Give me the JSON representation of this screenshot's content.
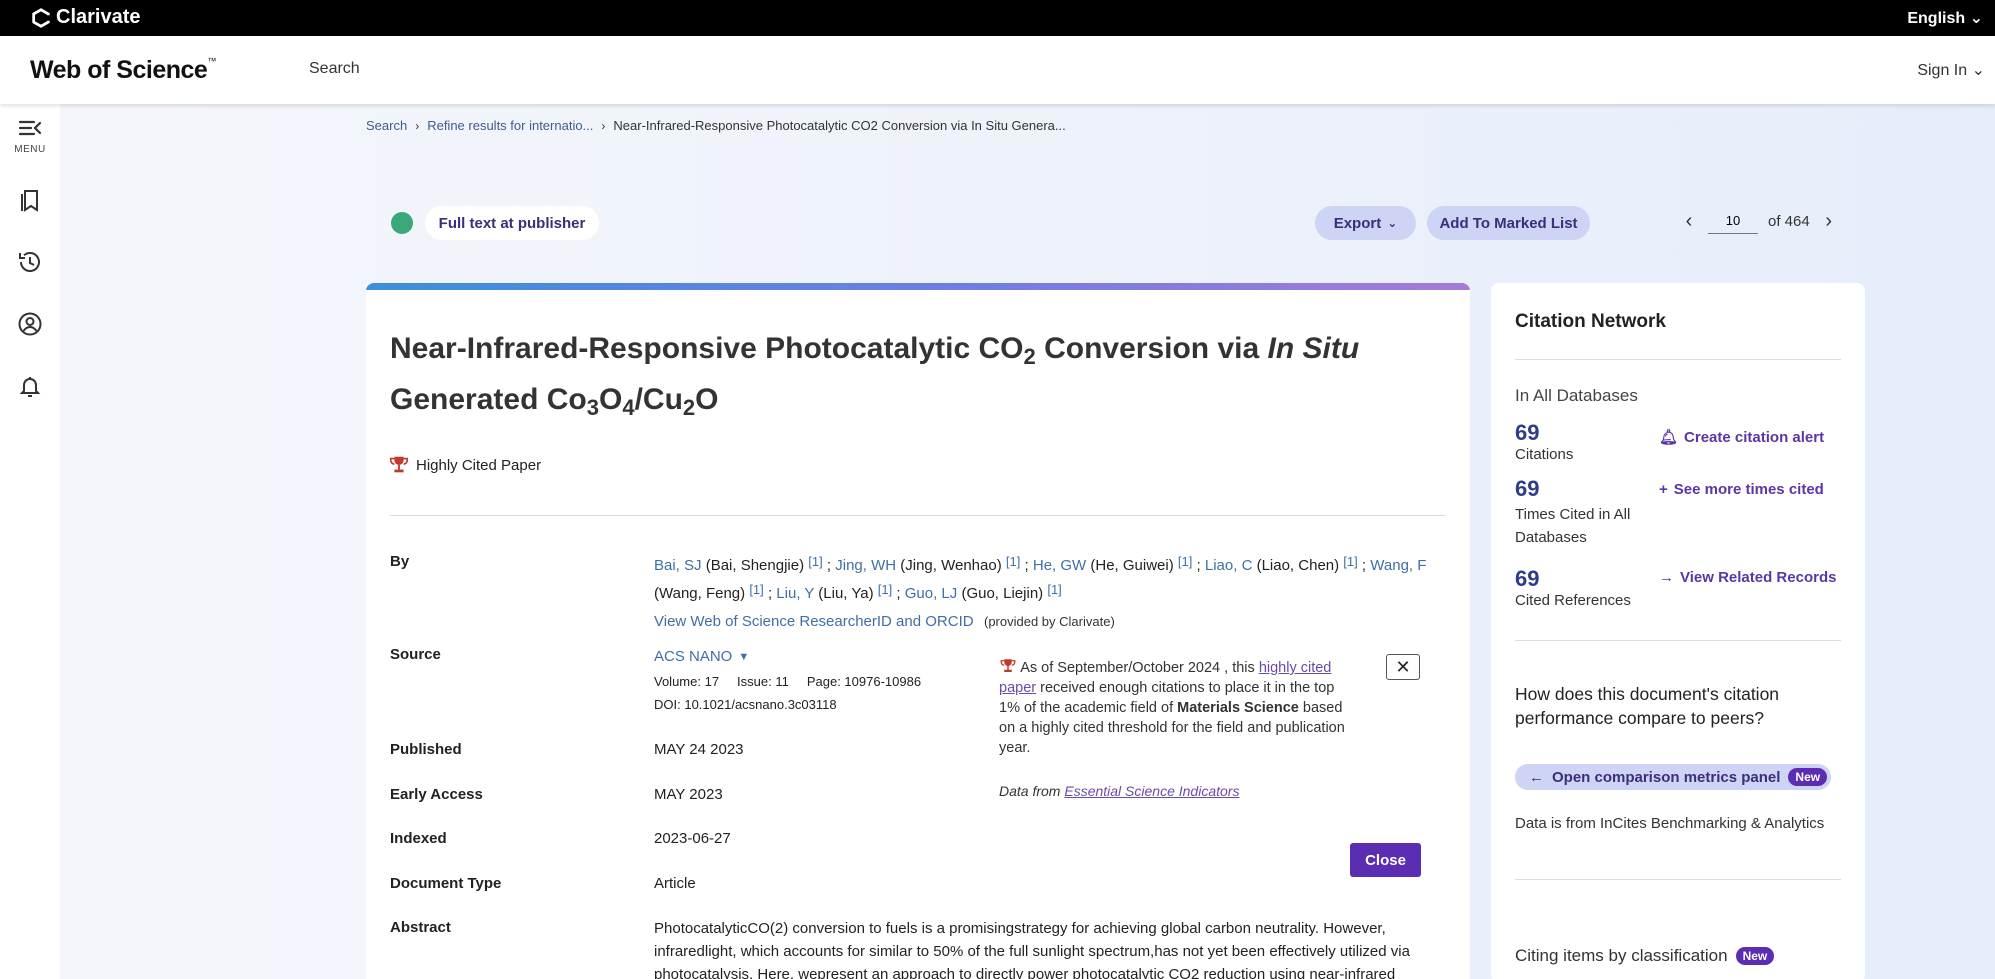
{
  "topbar": {
    "brand": "Clarivate",
    "language": "English ⌄"
  },
  "header": {
    "logo": "Web of Science",
    "logo_tm": "™",
    "search": "Search",
    "signin": "Sign In ⌄"
  },
  "sidebar": {
    "menu_label": "MENU"
  },
  "breadcrumb": {
    "items": [
      "Search",
      "Refine results for internatio...",
      "Near-Infrared-Responsive Photocatalytic CO2 Conversion via In Situ Genera..."
    ]
  },
  "actions": {
    "full_text": "Full text at publisher",
    "export": "Export",
    "add_marked": "Add To Marked List"
  },
  "pager": {
    "current": "10",
    "of_label": "of 464"
  },
  "record": {
    "title_part1": "Near-Infrared-Responsive Photocatalytic CO",
    "title_sub1": "2",
    "title_part2": " Conversion via ",
    "title_italic": "In Situ",
    "title_part3": "Generated Co",
    "title_sub2": "3",
    "title_part4": "O",
    "title_sub3": "4",
    "title_part5": "/Cu",
    "title_sub4": "2",
    "title_part6": "O",
    "highly_cited": "Highly Cited Paper",
    "by_label": "By",
    "authors": [
      {
        "short": "Bai, SJ",
        "full": " (Bai, Shengjie) ",
        "ref": "[1]"
      },
      {
        "short": "Jing, WH",
        "full": " (Jing, Wenhao) ",
        "ref": "[1]"
      },
      {
        "short": "He, GW",
        "full": " (He, Guiwei) ",
        "ref": "[1]"
      },
      {
        "short": "Liao, C",
        "full": " (Liao, Chen) ",
        "ref": "[1]"
      },
      {
        "short": "Wang, F",
        "full": " (Wang, Feng) ",
        "ref": "[1]"
      },
      {
        "short": "Liu, Y",
        "full": " (Liu, Ya) ",
        "ref": "[1]"
      },
      {
        "short": "Guo, LJ",
        "full": " (Guo, Liejin) ",
        "ref": "[1]"
      }
    ],
    "researcher_link": "View Web of Science ResearcherID and ORCID",
    "researcher_note": "(provided by Clarivate)",
    "source_label": "Source",
    "source_name": "ACS NANO",
    "volume": "Volume: 17",
    "issue": "Issue: 11",
    "page": "Page: 10976-10986",
    "doi": "DOI: 10.1021/acsnano.3c03118",
    "published_label": "Published",
    "published": "MAY 24 2023",
    "early_access_label": "Early Access",
    "early_access": "MAY 2023",
    "indexed_label": "Indexed",
    "indexed": "2023-06-27",
    "doctype_label": "Document Type",
    "doctype": "Article",
    "abstract_label": "Abstract",
    "abstract": "PhotocatalyticCO(2) conversion to fuels is a promisingstrategy for achieving global carbon neutrality. However, infraredlight, which accounts for similar to 50% of the full sunlight spectrum,has not yet been effectively utilized via photocatalysis. Here, wepresent an approach to directly power photocatalytic CO2 reduction using near-infrared"
  },
  "hcp_popup": {
    "text1": "As of September/October 2024 , this ",
    "link": "highly cited paper",
    "text2": " received enough citations to place it in the top 1% of the academic field of ",
    "field": "Materials Science",
    "text3": " based on a highly cited threshold for the field and publication year.",
    "data_from": "Data from ",
    "data_link": "Essential Science Indicators",
    "close_x": "✕",
    "close_button": "Close"
  },
  "citation_network": {
    "title": "Citation Network",
    "subtitle": "In All Databases",
    "citations_num": "69",
    "citations_label": "Citations",
    "create_alert": "Create citation alert",
    "times_cited_num": "69",
    "times_cited_label": "Times Cited in All Databases",
    "see_more": "See more times cited",
    "cited_refs_num": "69",
    "cited_refs_label": "Cited References",
    "view_related": "View Related Records",
    "compare_q": "How does this document's citation performance compare to peers?",
    "compare_btn": "Open comparison metrics panel",
    "new_badge": "New",
    "data_info": "Data is from InCites Benchmarking & Analytics",
    "citing_items": "Citing items by classification"
  }
}
